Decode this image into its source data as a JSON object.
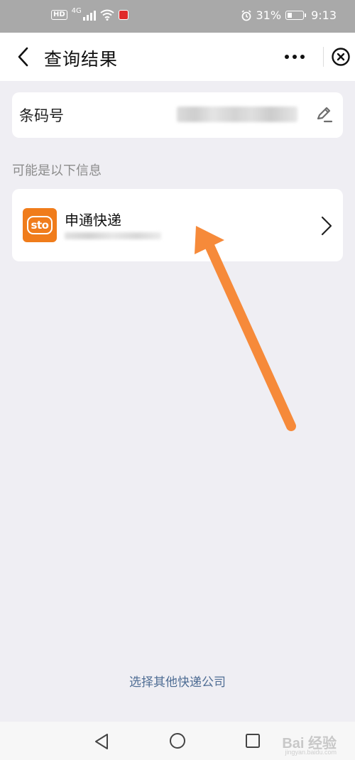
{
  "status_bar": {
    "hd_badge": "HD",
    "network": "4G",
    "battery": "31%",
    "battery_level": 0.31,
    "time": "9:13",
    "icons": [
      "hd-icon",
      "signal-icon",
      "wifi-icon",
      "app-notification-icon",
      "alarm-icon",
      "battery-icon"
    ]
  },
  "navbar": {
    "title": "查询结果",
    "icons": [
      "back-icon",
      "more-icon",
      "close-icon"
    ]
  },
  "barcode": {
    "label": "条码号",
    "value_state": "blurred",
    "icon": "edit-icon"
  },
  "hint": "可能是以下信息",
  "result": {
    "logo_text": "sto",
    "company": "申通快递",
    "tracking_state": "blurred",
    "icon": "chevron-right-icon"
  },
  "bottom_link": "选择其他快递公司",
  "annotation_arrow_color": "#f68a3a",
  "system_nav": {
    "icons": [
      "system-back-icon",
      "system-home-icon",
      "system-recent-icon"
    ]
  },
  "watermark": {
    "text": "Bai  经验",
    "sub": "jingyan.baidu.com"
  },
  "colors": {
    "background": "#efeef3",
    "status_bar": "#a9a9a9",
    "card": "#ffffff",
    "link": "#4f6d94",
    "logo": "#f07c1b"
  }
}
